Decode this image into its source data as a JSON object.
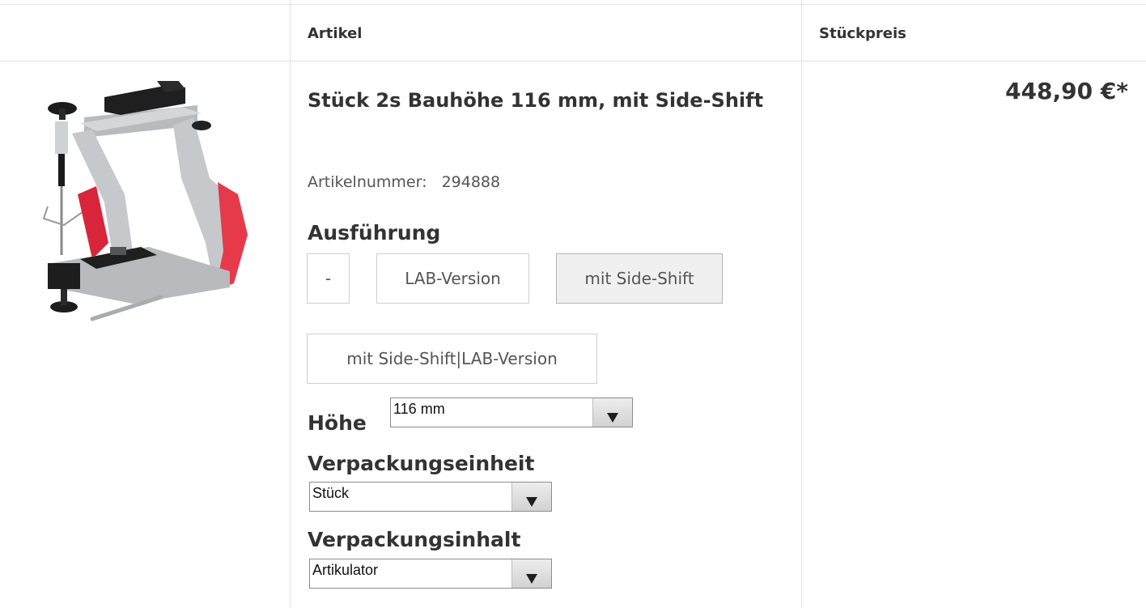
{
  "table": {
    "headers": {
      "article": "Artikel",
      "unit_price": "Stückpreis"
    }
  },
  "product": {
    "title": "Stück 2s Bauhöhe 116 mm, mit Side-Shift",
    "article_number_label": "Artikelnummer:",
    "article_number": "294888",
    "price": "448,90 €*",
    "image_icon": "articulator-product-image"
  },
  "variants": {
    "ausfuehrung": {
      "label": "Ausführung",
      "options": [
        "-",
        "LAB-Version",
        "mit Side-Shift",
        "mit Side-Shift|LAB-Version"
      ],
      "selected": "mit Side-Shift"
    },
    "hoehe": {
      "label": "Höhe",
      "value": "116 mm"
    },
    "verpackungseinheit": {
      "label": "Verpackungseinheit",
      "value": "Stück"
    },
    "verpackungsinhalt": {
      "label": "Verpackungsinhalt",
      "value": "Artikulator"
    }
  },
  "colors": {
    "border": "#e2e2e2",
    "text": "#333333",
    "selected_bg": "#f0f0f0",
    "accent_red": "#e63a4a"
  }
}
